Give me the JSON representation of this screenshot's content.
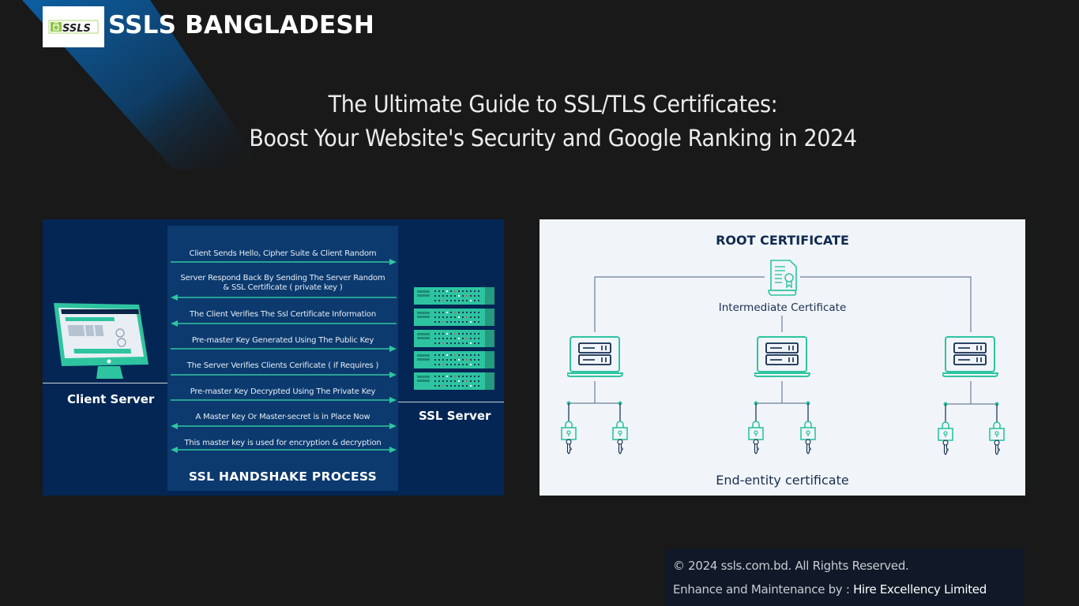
{
  "brand": {
    "logo_text": "SSLS",
    "name": "SSLS BANGLADESH"
  },
  "headline": {
    "line1": "The Ultimate Guide to SSL/TLS Certificates:",
    "line2": "Boost Your Website's Security and Google Ranking in 2024"
  },
  "handshake_diagram": {
    "title": "SSL HANDSHAKE PROCESS",
    "client_label": "Client Server",
    "server_label": "SSL Server",
    "steps": [
      {
        "lines": [
          "Client Sends Hello, Cipher Suite & Client Random"
        ],
        "direction": "right"
      },
      {
        "lines": [
          "Server Respond Back By Sending The Server Random",
          "& SSL Certificate ( private key )"
        ],
        "direction": "left"
      },
      {
        "lines": [
          "The Client Verifies The Ssl Certificate Information"
        ],
        "direction": "left"
      },
      {
        "lines": [
          "Pre-master Key Generated Using The Public Key"
        ],
        "direction": "right"
      },
      {
        "lines": [
          "The Server Verifies Clients Cerificate ( if Requires )"
        ],
        "direction": "right"
      },
      {
        "lines": [
          "Pre-master Key Decrypted Using The Private Key"
        ],
        "direction": "right"
      },
      {
        "lines": [
          "A Master Key Or Master-secret is in Place Now"
        ],
        "direction": "both"
      },
      {
        "lines": [
          "This master key is used for encryption & decryption"
        ],
        "direction": "both"
      }
    ],
    "colors": {
      "background": "#032654",
      "center_panel": "#0c3a6e",
      "arrow": "#2ec4a0",
      "device": "#2ec4a0"
    }
  },
  "pki_diagram": {
    "root_label": "ROOT CERTIFICATE",
    "intermediate_label": "Intermediate Certificate",
    "end_entity_label": "End-entity certificate",
    "server_nodes": 3,
    "keys_per_node": 2,
    "colors": {
      "background": "#f1f5f9",
      "accent": "#2ec4a0",
      "line": "#6b7f99",
      "text": "#0f2a4f"
    }
  },
  "footer": {
    "copyright": "© 2024 ssls.com.bd. All Rights Reserved.",
    "maintenance_prefix": "Enhance and Maintenance by : ",
    "maintainer": "Hire Excellency Limited"
  }
}
